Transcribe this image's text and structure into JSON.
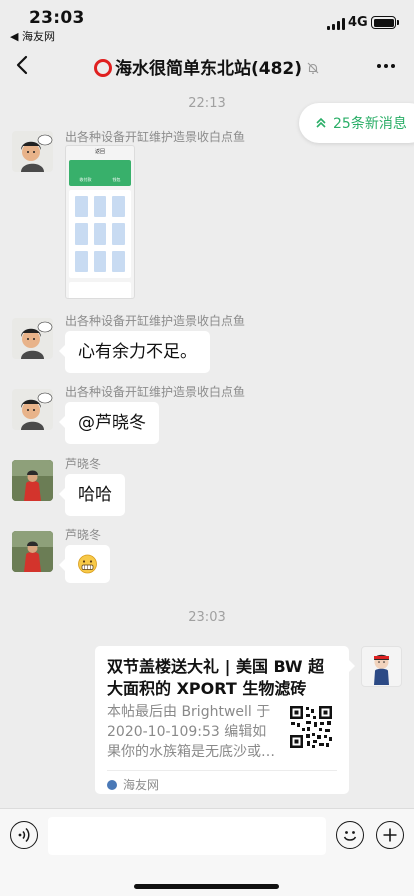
{
  "status_bar": {
    "time": "23:03",
    "back_app": "◀ 海友网",
    "network": "4G"
  },
  "nav": {
    "title": "海水很简单东北站(482)"
  },
  "new_messages": {
    "label": "25条新消息"
  },
  "timestamps": [
    "22:13",
    "23:03"
  ],
  "messages": [
    {
      "sender": "出各种设备开缸维护造景收白点鱼",
      "type": "image",
      "image": {
        "header": "返回",
        "tile_a": "收付款",
        "tile_b": "钱包"
      }
    },
    {
      "sender": "出各种设备开缸维护造景收白点鱼",
      "type": "text",
      "text": "心有余力不足。"
    },
    {
      "sender": "出各种设备开缸维护造景收白点鱼",
      "type": "text",
      "text": "@芦晓冬"
    },
    {
      "sender": "芦晓冬",
      "type": "text",
      "text": "哈哈"
    },
    {
      "sender": "芦晓冬",
      "type": "emoji",
      "text": "😬"
    }
  ],
  "link_card": {
    "title": "双节盖楼送大礼 | 美国 BW 超大面积的 XPORT 生物滤砖等…",
    "description": "本帖最后由 Brightwell 于 2020-10-109:53 编辑如果你的水族箱是无底沙或…",
    "source": "海友网"
  },
  "colors": {
    "accent": "#2aae67",
    "background": "#ededed",
    "title_ring": "#e02020"
  },
  "icons": [
    "back-chevron-icon",
    "mute-bell-icon",
    "more-dots-icon",
    "voice-icon",
    "emoji-icon",
    "add-icon"
  ]
}
